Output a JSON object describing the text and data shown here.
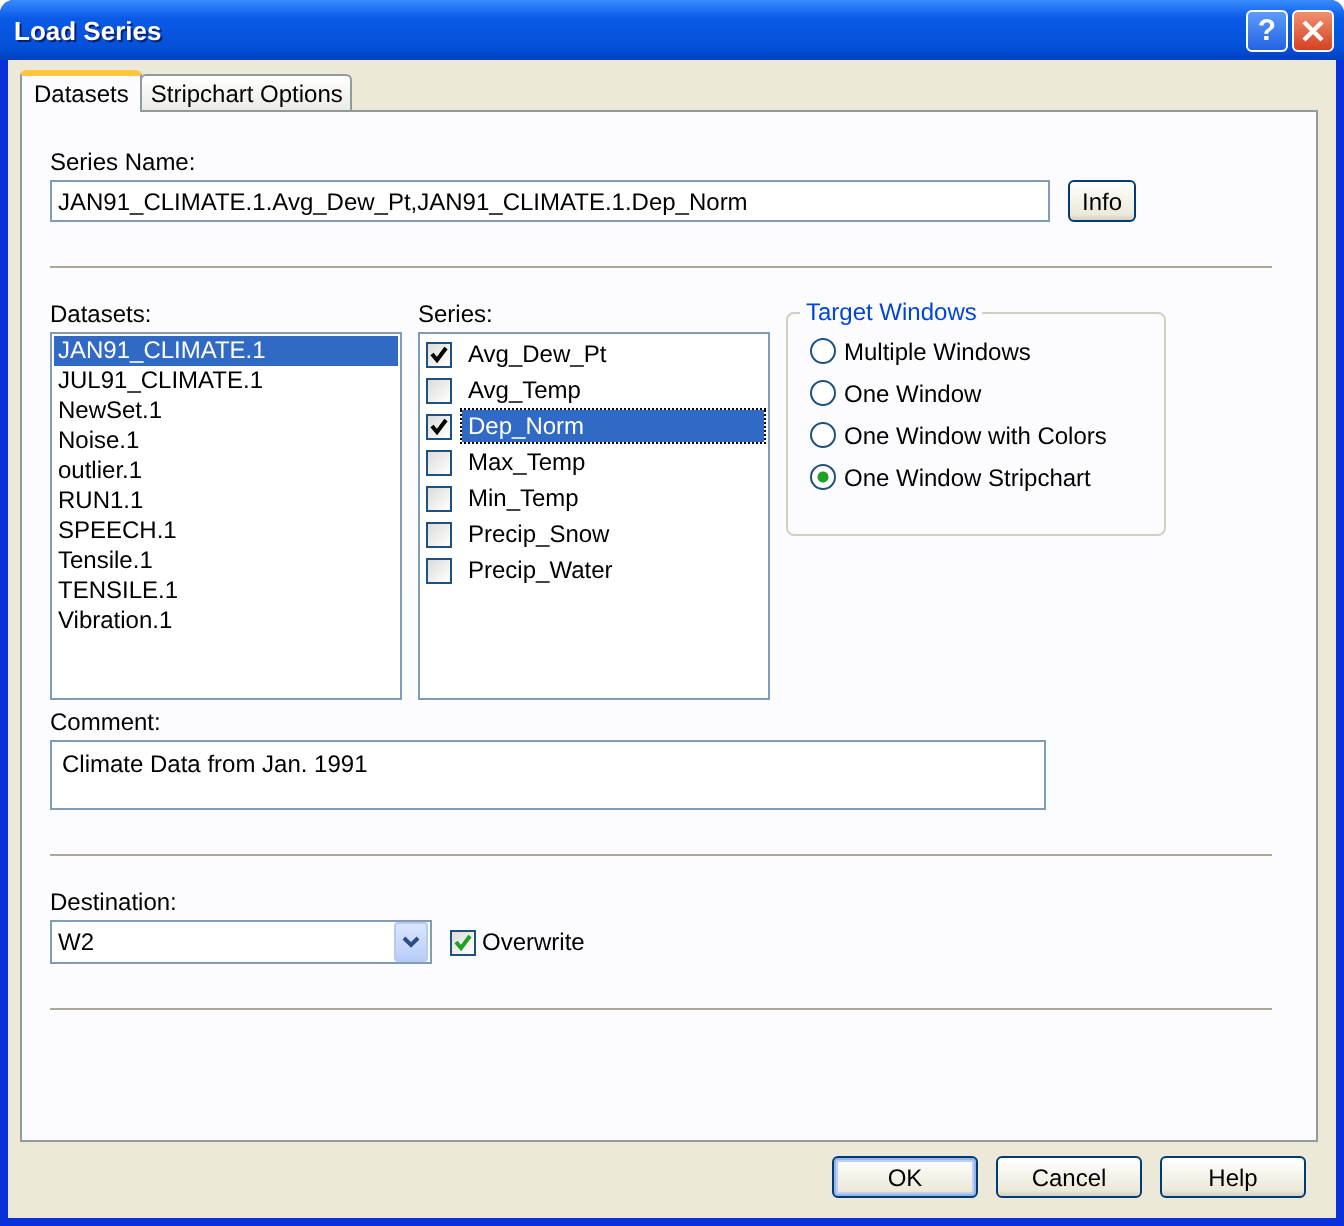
{
  "window": {
    "title": "Load Series",
    "help_button": "?"
  },
  "tabs": [
    {
      "label": "Datasets",
      "selected": true
    },
    {
      "label": "Stripchart Options",
      "selected": false
    }
  ],
  "series_name": {
    "label": "Series Name:",
    "value": "JAN91_CLIMATE.1.Avg_Dew_Pt,JAN91_CLIMATE.1.Dep_Norm",
    "info_button": "Info"
  },
  "datasets": {
    "label": "Datasets:",
    "items": [
      {
        "text": "JAN91_CLIMATE.1",
        "selected": true
      },
      {
        "text": "JUL91_CLIMATE.1",
        "selected": false
      },
      {
        "text": "NewSet.1",
        "selected": false
      },
      {
        "text": "Noise.1",
        "selected": false
      },
      {
        "text": "outlier.1",
        "selected": false
      },
      {
        "text": "RUN1.1",
        "selected": false
      },
      {
        "text": "SPEECH.1",
        "selected": false
      },
      {
        "text": "Tensile.1",
        "selected": false
      },
      {
        "text": "TENSILE.1",
        "selected": false
      },
      {
        "text": "Vibration.1",
        "selected": false
      }
    ]
  },
  "series": {
    "label": "Series:",
    "items": [
      {
        "text": "Avg_Dew_Pt",
        "checked": true,
        "selected": false
      },
      {
        "text": "Avg_Temp",
        "checked": false,
        "selected": false
      },
      {
        "text": "Dep_Norm",
        "checked": true,
        "selected": true
      },
      {
        "text": "Max_Temp",
        "checked": false,
        "selected": false
      },
      {
        "text": "Min_Temp",
        "checked": false,
        "selected": false
      },
      {
        "text": "Precip_Snow",
        "checked": false,
        "selected": false
      },
      {
        "text": "Precip_Water",
        "checked": false,
        "selected": false
      }
    ]
  },
  "target_windows": {
    "title": "Target Windows",
    "options": [
      {
        "label": "Multiple Windows",
        "selected": false
      },
      {
        "label": "One Window",
        "selected": false
      },
      {
        "label": "One Window with Colors",
        "selected": false
      },
      {
        "label": "One Window Stripchart",
        "selected": true
      }
    ]
  },
  "comment": {
    "label": "Comment:",
    "value": "Climate Data from Jan. 1991"
  },
  "destination": {
    "label": "Destination:",
    "value": "W2"
  },
  "overwrite": {
    "label": "Overwrite",
    "checked": true
  },
  "buttons": [
    {
      "label": "OK",
      "default": true
    },
    {
      "label": "Cancel",
      "default": false
    },
    {
      "label": "Help",
      "default": false
    }
  ]
}
